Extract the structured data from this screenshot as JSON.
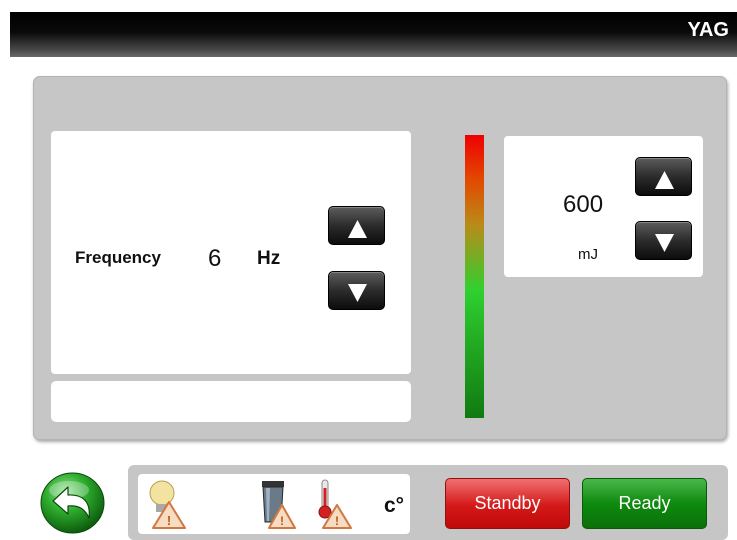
{
  "header": {
    "title": "YAG"
  },
  "frequency": {
    "label": "Frequency",
    "value": "6",
    "unit": "Hz"
  },
  "energy": {
    "value": "600",
    "unit": "mJ"
  },
  "status": {
    "temperature_unit": "c°"
  },
  "actions": {
    "standby_label": "Standby",
    "ready_label": "Ready"
  },
  "icons": {
    "back": "back-arrow-icon",
    "lamp": "lamp-warning-icon",
    "water": "water-tank-warning-icon",
    "temperature": "thermometer-warning-icon"
  },
  "colors": {
    "standby": "#d41818",
    "ready": "#0e8a0e",
    "panel": "#c6c6c6"
  }
}
